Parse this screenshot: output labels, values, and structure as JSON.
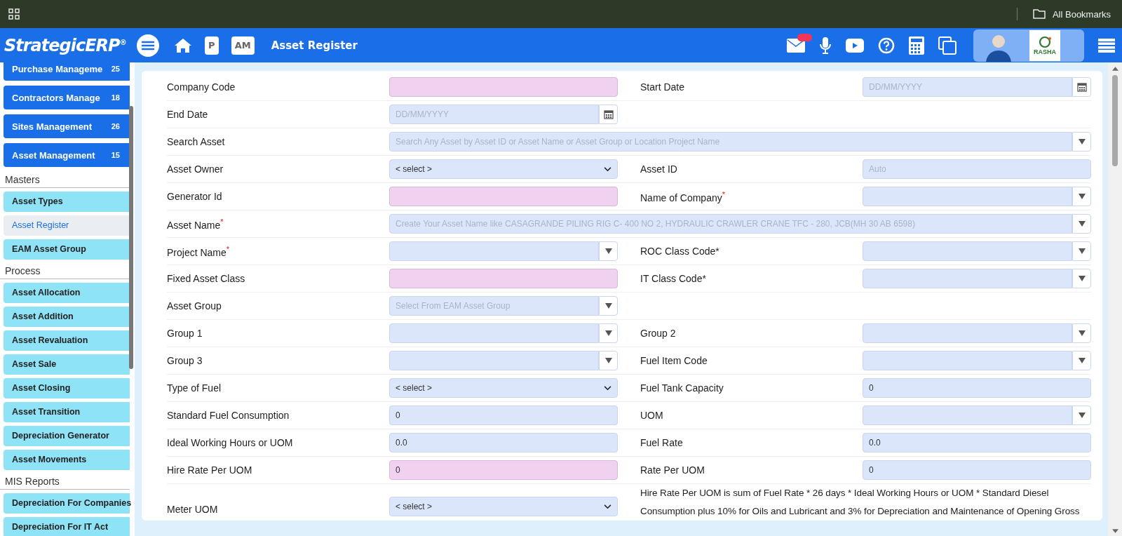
{
  "browser_bar": {
    "bookmarks_label": "All Bookmarks"
  },
  "header": {
    "logo": "StrategicERP$^{®}$",
    "shortcuts": [
      "P",
      "AM"
    ],
    "title": "Asset Register",
    "company_logo_text": "RASHA"
  },
  "sidebar": {
    "modules": [
      {
        "label": "Purchase Manageme",
        "count": "25"
      },
      {
        "label": "Contractors Manage",
        "count": "18"
      },
      {
        "label": "Sites Management",
        "count": "26"
      },
      {
        "label": "Asset Management",
        "count": "15"
      }
    ],
    "sections": [
      {
        "title": "Masters",
        "items": [
          {
            "label": "Asset Types",
            "selected": false
          },
          {
            "label": "Asset Register",
            "selected": true
          },
          {
            "label": "EAM Asset Group",
            "selected": false
          }
        ]
      },
      {
        "title": "Process",
        "items": [
          {
            "label": "Asset Allocation",
            "selected": false
          },
          {
            "label": "Asset Addition",
            "selected": false
          },
          {
            "label": "Asset Revaluation",
            "selected": false
          },
          {
            "label": "Asset Sale",
            "selected": false
          },
          {
            "label": "Asset Closing",
            "selected": false
          },
          {
            "label": "Asset Transition",
            "selected": false
          },
          {
            "label": "Depreciation Generator",
            "selected": false
          },
          {
            "label": "Asset Movements",
            "selected": false
          }
        ]
      },
      {
        "title": "MIS Reports",
        "items": [
          {
            "label": "Depreciation For Companies",
            "selected": false
          },
          {
            "label": "Depreciation For IT Act",
            "selected": false
          }
        ]
      }
    ]
  },
  "form": {
    "rows": [
      {
        "cells": [
          {
            "label": "Company Code",
            "field": {
              "kind": "text",
              "highlighted": true
            }
          },
          {
            "label": "Start Date",
            "field": {
              "kind": "date",
              "placeholder": "DD/MM/YYYY",
              "highlighted": false
            }
          }
        ]
      },
      {
        "cells": [
          {
            "label": "End Date",
            "field": {
              "kind": "date",
              "placeholder": "DD/MM/YYYY",
              "highlighted": false
            }
          }
        ]
      },
      {
        "cells": [
          {
            "label": "Search Asset",
            "field": {
              "kind": "wide_combo",
              "placeholder": "Search Any Asset by Asset ID or Asset Name or Asset Group or Location Project Name",
              "highlighted": false
            }
          }
        ]
      },
      {
        "cells": [
          {
            "label": "Asset Owner",
            "field": {
              "kind": "select",
              "value": "< select >",
              "highlighted": false
            }
          },
          {
            "label": "Asset ID",
            "field": {
              "kind": "text",
              "placeholder": "Auto",
              "highlighted": false
            }
          }
        ]
      },
      {
        "cells": [
          {
            "label": "Generator Id",
            "field": {
              "kind": "text",
              "highlighted": true
            }
          },
          {
            "label": "Name of Company$^{*}$",
            "field": {
              "kind": "combo",
              "highlighted": false
            }
          }
        ]
      },
      {
        "cells": [
          {
            "label": "Asset Name$^{*}$",
            "field": {
              "kind": "wide_combo",
              "placeholder": "Create Your Asset Name like CASAGRANDE PILING RIG C- 400 NO 2, HYDRAULIC CRAWLER CRANE TFC - 280, JCB(MH 30 AB 6598)",
              "highlighted": false
            }
          }
        ]
      },
      {
        "cells": [
          {
            "label": "Project Name$^{*}$",
            "field": {
              "kind": "combo",
              "highlighted": false
            }
          },
          {
            "label": "ROC Class Code*",
            "field": {
              "kind": "combo",
              "highlighted": false
            }
          }
        ]
      },
      {
        "cells": [
          {
            "label": "Fixed Asset Class",
            "field": {
              "kind": "text",
              "highlighted": true
            }
          },
          {
            "label": "IT Class Code*",
            "field": {
              "kind": "combo",
              "highlighted": false
            }
          }
        ]
      },
      {
        "cells": [
          {
            "label": "Asset Group",
            "field": {
              "kind": "combo",
              "placeholder": "Select From EAM Asset Group",
              "highlighted": false
            }
          }
        ]
      },
      {
        "cells": [
          {
            "label": "Group 1",
            "field": {
              "kind": "combo",
              "highlighted": false
            }
          },
          {
            "label": "Group 2",
            "field": {
              "kind": "combo",
              "highlighted": false
            }
          }
        ]
      },
      {
        "cells": [
          {
            "label": "Group 3",
            "field": {
              "kind": "combo",
              "highlighted": false
            }
          },
          {
            "label": "Fuel Item Code",
            "field": {
              "kind": "combo",
              "highlighted": false
            }
          }
        ]
      },
      {
        "cells": [
          {
            "label": "Type of Fuel",
            "field": {
              "kind": "select",
              "value": "< select >",
              "highlighted": false
            }
          },
          {
            "label": "Fuel Tank Capacity",
            "field": {
              "kind": "text",
              "value": "0",
              "highlighted": false
            }
          }
        ]
      },
      {
        "cells": [
          {
            "label": "Standard Fuel Consumption",
            "field": {
              "kind": "text",
              "value": "0",
              "highlighted": false
            }
          },
          {
            "label": "UOM",
            "field": {
              "kind": "combo",
              "highlighted": false
            }
          }
        ]
      },
      {
        "cells": [
          {
            "label": "Ideal Working Hours or UOM",
            "field": {
              "kind": "text",
              "value": "0.0",
              "highlighted": false
            }
          },
          {
            "label": "Fuel Rate",
            "field": {
              "kind": "text",
              "value": "0.0",
              "highlighted": false
            }
          }
        ]
      },
      {
        "cells": [
          {
            "label": "Hire Rate Per UOM",
            "field": {
              "kind": "text",
              "value": "0",
              "highlighted": true
            }
          },
          {
            "label": "Rate Per UOM",
            "field": {
              "kind": "text",
              "value": "0",
              "highlighted": false
            }
          }
        ]
      },
      {
        "cells": [
          {
            "label": "Meter UOM",
            "field": {
              "kind": "select",
              "value": "< select >",
              "highlighted": false
            }
          }
        ],
        "note": "Hire Rate Per UOM is sum of Fuel Rate * 26 days * Ideal Working Hours or UOM * Standard Diesel Consumption plus 10% for Oils and Lubricant and 3% for Depreciation and Maintenance of Opening Gross"
      }
    ]
  }
}
